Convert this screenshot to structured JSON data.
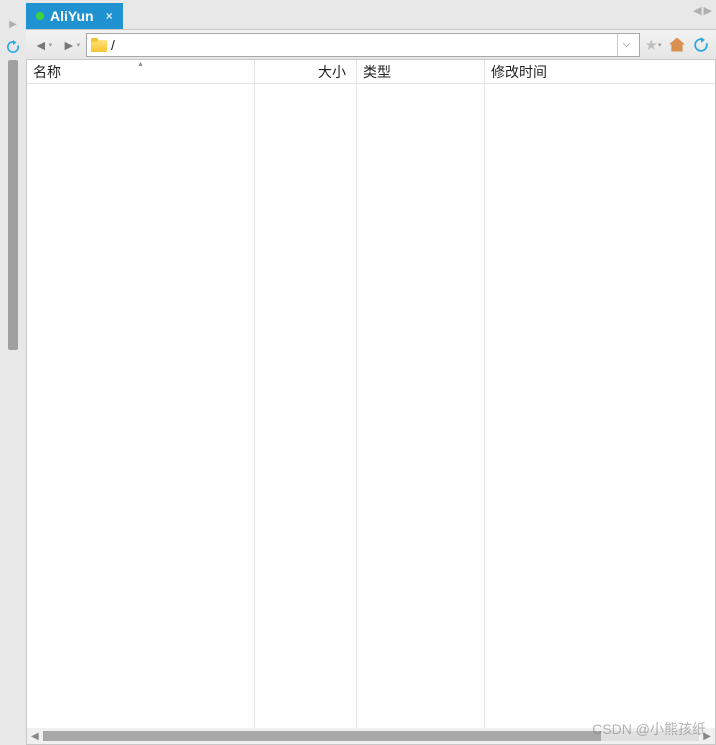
{
  "tab": {
    "label": "AliYun",
    "close_glyph": "×"
  },
  "toolbar": {
    "path": "/"
  },
  "columns": {
    "name": "名称",
    "size": "大小",
    "type": "类型",
    "modified": "修改时间"
  },
  "watermark": "CSDN @小熊孩纸"
}
